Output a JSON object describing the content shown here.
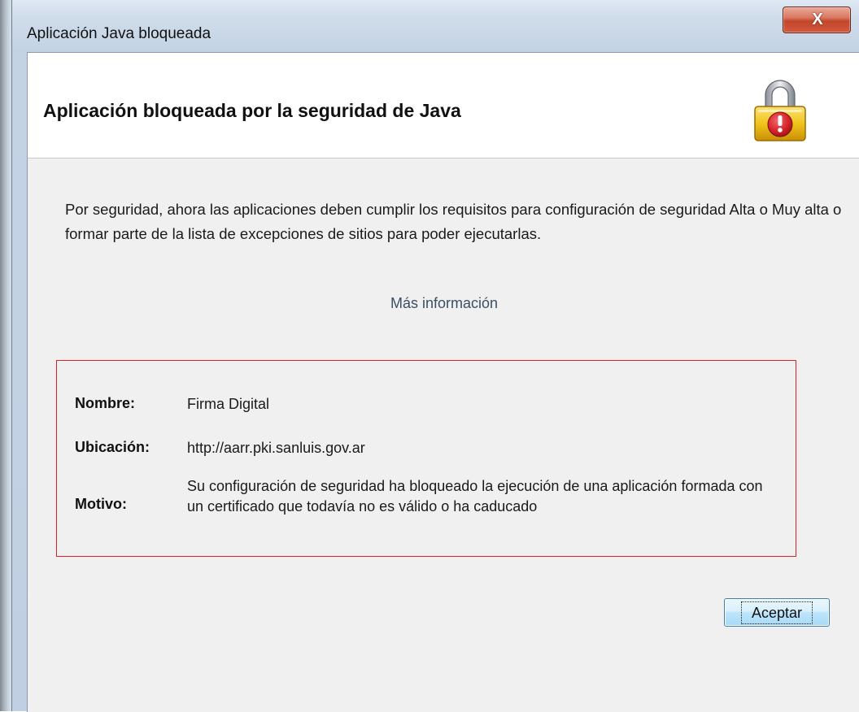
{
  "window": {
    "title": "Aplicación Java bloqueada",
    "close_symbol": "X"
  },
  "header": {
    "title": "Aplicación bloqueada por la seguridad de Java",
    "icon": "padlock-warning-icon"
  },
  "message": {
    "text": "Por seguridad, ahora las aplicaciones deben cumplir los requisitos para configuración de seguridad Alta o Muy alta o formar parte de la lista de excepciones de sitios para poder ejecutarlas."
  },
  "more_info": {
    "label": "Más información"
  },
  "details": {
    "name_label": "Nombre:",
    "name_value": "Firma Digital",
    "location_label": "Ubicación:",
    "location_value": "http://aarr.pki.sanluis.gov.ar",
    "reason_label": "Motivo:",
    "reason_value": "Su configuración de seguridad ha bloqueado la ejecución de una aplicación formada con un certificado que todavía no es válido o ha caducado"
  },
  "buttons": {
    "accept_label": "Aceptar"
  },
  "colors": {
    "details_border": "#d9202b",
    "link": "#3a4f66",
    "lock_body": "#f0c419",
    "warning_badge": "#d8262b"
  }
}
